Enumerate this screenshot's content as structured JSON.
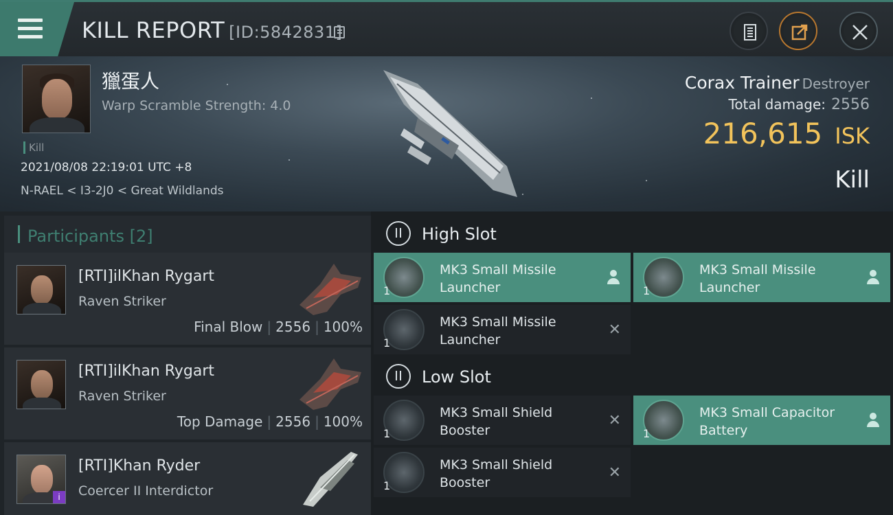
{
  "header": {
    "title": "KILL REPORT",
    "report_id": "[ID:5842831]"
  },
  "victim": {
    "pilot_name": "獵蛋人",
    "warp_scramble": "Warp Scramble Strength: 4.0",
    "kill_tag": "Kill",
    "datetime": "2021/08/08 22:19:01 UTC +8",
    "location": "N-RAEL < I3-2J0 < Great Wildlands",
    "ship_name": "Corax Trainer",
    "ship_class": "Destroyer",
    "total_damage_label": "Total damage:",
    "total_damage": "2556",
    "isk_value": "216,615",
    "isk_unit": "ISK",
    "result": "Kill"
  },
  "participants": {
    "title": "Participants [2]",
    "items": [
      {
        "name": "[RTI]ilKhan Rygart",
        "ship": "Raven Striker",
        "tag": "Final Blow",
        "damage": "2556",
        "percent": "100%"
      },
      {
        "name": "[RTI]ilKhan Rygart",
        "ship": "Raven Striker",
        "tag": "Top Damage",
        "damage": "2556",
        "percent": "100%"
      },
      {
        "name": "[RTI]Khan Ryder",
        "ship": "Coercer II Interdictor",
        "badge": "i"
      }
    ]
  },
  "fitting": {
    "high_slot": {
      "label": "High Slot",
      "modules": [
        {
          "name": "MK3 Small Missile Launcher",
          "qty": "1",
          "state": "dropped"
        },
        {
          "name": "MK3 Small Missile Launcher",
          "qty": "1",
          "state": "dropped"
        },
        {
          "name": "MK3 Small Missile Launcher",
          "qty": "1",
          "state": "destroyed"
        }
      ]
    },
    "low_slot": {
      "label": "Low Slot",
      "modules": [
        {
          "name": "MK3 Small Shield Booster",
          "qty": "1",
          "state": "destroyed"
        },
        {
          "name": "MK3 Small Capacitor Battery",
          "qty": "1",
          "state": "dropped"
        },
        {
          "name": "MK3 Small Shield Booster",
          "qty": "1",
          "state": "destroyed"
        }
      ]
    }
  },
  "icons": {
    "menu": "menu-icon",
    "copy": "copy-icon",
    "document": "document-icon",
    "share": "share-icon",
    "close": "close-icon",
    "module_dropped": "person-icon",
    "module_destroyed": "x-icon"
  },
  "colors": {
    "accent": "#3d7a6d",
    "isk": "#f2c35b",
    "dropped_bg": "#4a8f7e"
  }
}
